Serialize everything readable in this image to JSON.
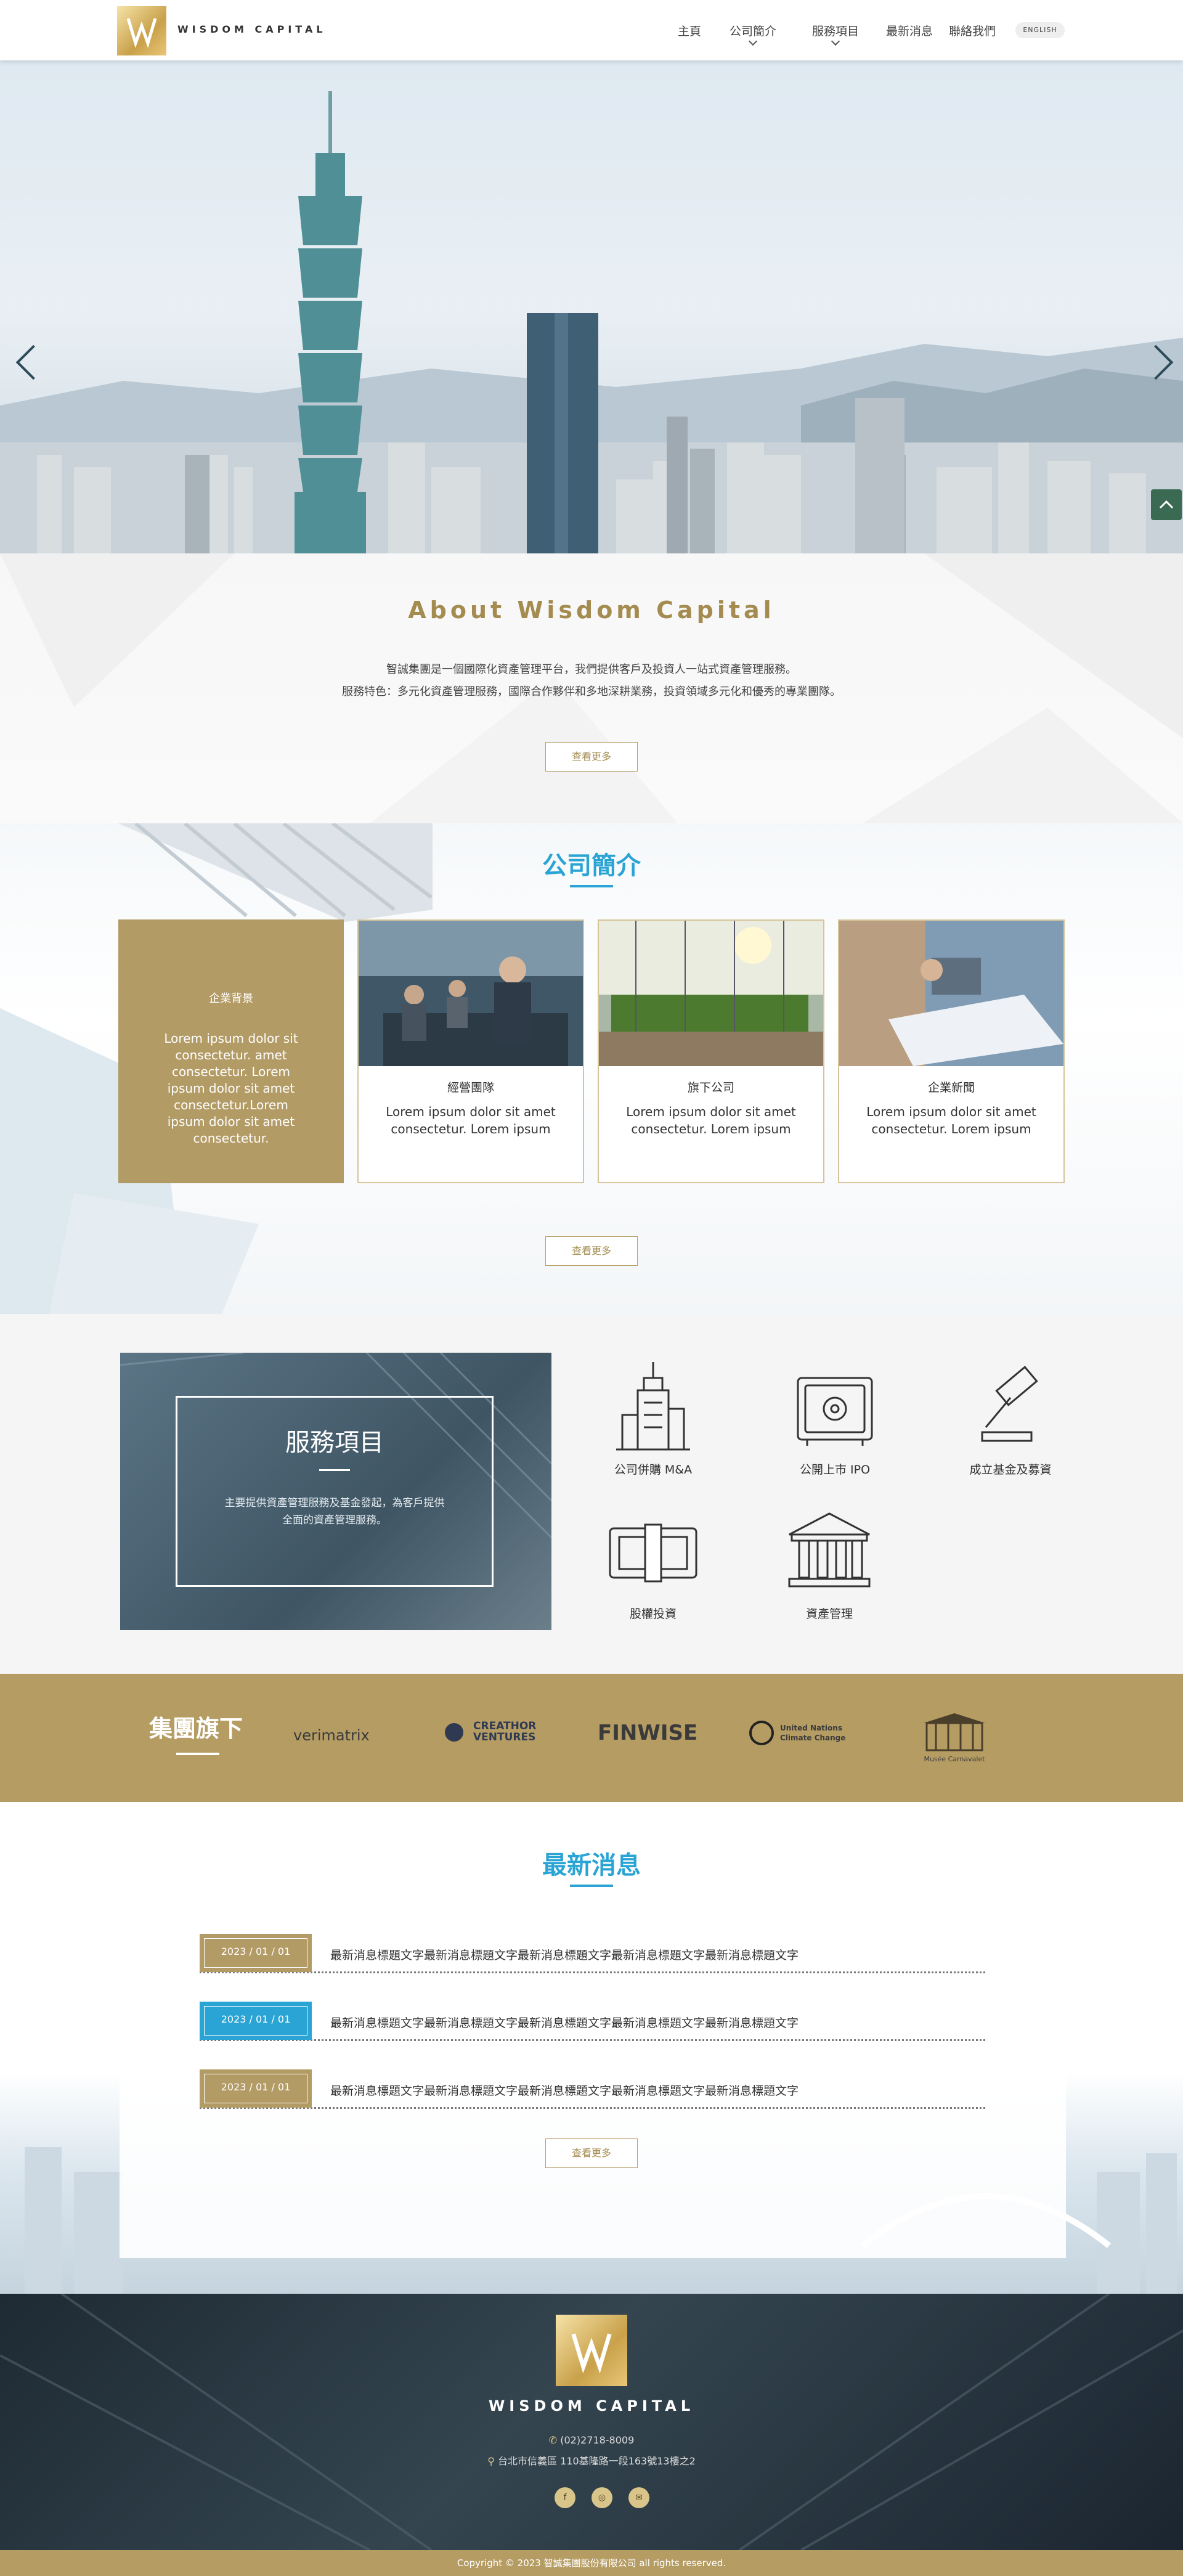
{
  "header": {
    "logo_text": "WISDOM CAPITAL",
    "nav": [
      {
        "label": "主頁",
        "has_dropdown": false
      },
      {
        "label": "公司簡介",
        "has_dropdown": true
      },
      {
        "label": "服務項目",
        "has_dropdown": true
      },
      {
        "label": "最新消息",
        "has_dropdown": false
      },
      {
        "label": "聯絡我們",
        "has_dropdown": false
      }
    ],
    "lang_button": "ENGLISH"
  },
  "about": {
    "title": "About Wisdom Capital",
    "line1": "智誠集團是一個國際化資產管理平台，我們提供客戶及投資人一站式資產管理服務。",
    "line2": "服務特色：多元化資產管理服務，國際合作夥伴和多地深耕業務，投資領域多元化和優秀的專業團隊。",
    "more": "查看更多"
  },
  "company": {
    "title": "公司簡介",
    "feature_card": {
      "title": "企業背景",
      "desc": "Lorem ipsum dolor sit consectetur. amet consectetur. Lorem ipsum dolor sit amet consectetur.Lorem ipsum dolor sit amet consectetur."
    },
    "cards": [
      {
        "title": "經營團隊",
        "desc": "Lorem ipsum dolor sit amet consectetur. Lorem ipsum"
      },
      {
        "title": "旗下公司",
        "desc": "Lorem ipsum dolor sit amet consectetur. Lorem ipsum"
      },
      {
        "title": "企業新聞",
        "desc": "Lorem ipsum dolor sit amet consectetur. Lorem ipsum"
      }
    ],
    "more": "查看更多"
  },
  "services": {
    "title": "服務項目",
    "desc_line1": "主要提供資產管理服務及基金發起，為客戶提供",
    "desc_line2": "全面的資產管理服務。",
    "items": [
      {
        "label": "公司併購 M&A",
        "icon": "buildings-icon"
      },
      {
        "label": "公開上市 IPO",
        "icon": "safe-icon"
      },
      {
        "label": "成立基金及募資",
        "icon": "gavel-icon"
      },
      {
        "label": "股權投資",
        "icon": "money-icon"
      },
      {
        "label": "資產管理",
        "icon": "bank-icon"
      }
    ]
  },
  "group": {
    "title": "集團旗下",
    "logos": [
      "verimatrix",
      "CREATHOR VENTURES",
      "FINWISE",
      "United Nations Climate Change",
      "Musée Carnavalet"
    ]
  },
  "news": {
    "title": "最新消息",
    "items": [
      {
        "date": "2023 / 01 / 01",
        "title": "最新消息標題文字最新消息標題文字最新消息標題文字最新消息標題文字最新消息標題文字",
        "active": false
      },
      {
        "date": "2023 / 01 / 01",
        "title": "最新消息標題文字最新消息標題文字最新消息標題文字最新消息標題文字最新消息標題文字",
        "active": true
      },
      {
        "date": "2023 / 01 / 01",
        "title": "最新消息標題文字最新消息標題文字最新消息標題文字最新消息標題文字最新消息標題文字",
        "active": false
      }
    ],
    "more": "查看更多"
  },
  "footer": {
    "name": "WISDOM CAPITAL",
    "phone": "(02)2718-8009",
    "address": "台北市信義區 110基隆路一段163號13樓之2",
    "copyright": "Copyright © 2023 智誠集團股份有限公司 all rights reserved."
  },
  "colors": {
    "gold": "#b39b65",
    "blue": "#2aa4d4",
    "footer_bg": "#26333d"
  }
}
